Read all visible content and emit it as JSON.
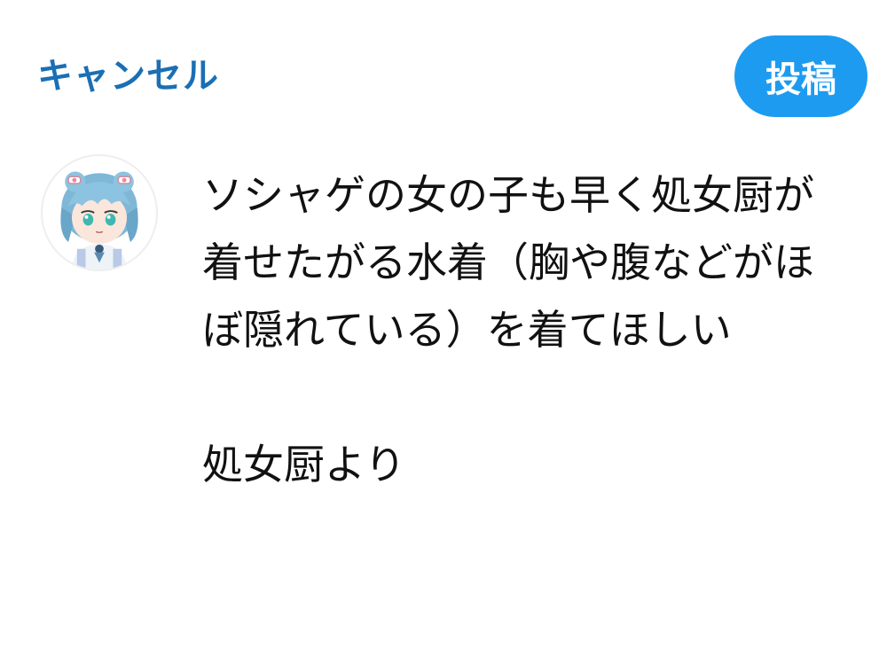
{
  "header": {
    "cancel_label": "キャンセル",
    "post_label": "投稿"
  },
  "compose": {
    "body": "ソシャゲの女の子も早く処女厨が着せたがる水着（胸や腹などがほぼ隠れている）を着てほしい",
    "signature": "処女厨より"
  },
  "avatar": {
    "icon": "user-avatar-anime-character"
  },
  "colors": {
    "accent": "#1d9bf0",
    "cancel_text": "#1a6fb5",
    "text": "#111111",
    "background": "#ffffff"
  }
}
